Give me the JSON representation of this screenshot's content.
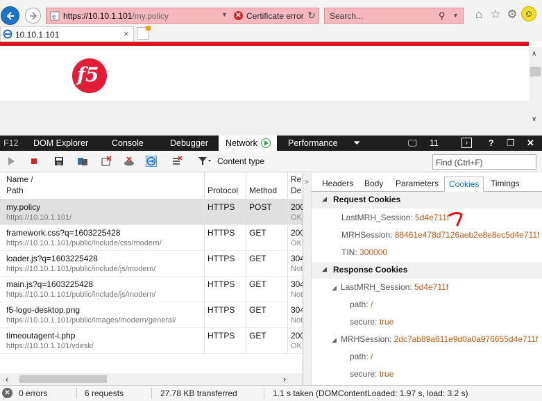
{
  "browser": {
    "address": {
      "scheme_host": "https://10.10.1.101",
      "path": "/my.policy",
      "cert_error_label": "Certificate error"
    },
    "search_placeholder": "Search...",
    "tab_title": "10.10.1.101",
    "icons": [
      "back-icon",
      "forward-icon",
      "home-icon",
      "favorites-star-icon",
      "settings-gear-icon",
      "feedback-smiley-icon"
    ]
  },
  "page": {
    "brand_color": "#d9161f",
    "logo_text": "f5"
  },
  "devtools": {
    "tabs": [
      {
        "label": "F12"
      },
      {
        "label": "DOM Explorer"
      },
      {
        "label": "Console"
      },
      {
        "label": "Debugger"
      },
      {
        "label": "Network"
      },
      {
        "label": "Performance"
      }
    ],
    "active_tab": "Network",
    "emulation_count": "11",
    "help_label": "?",
    "toolbar": {
      "content_type_label": "Content type",
      "find_placeholder": "Find (Ctrl+F)"
    },
    "columns": {
      "name": "Name /",
      "path": "Path",
      "protocol": "Protocol",
      "method": "Method",
      "result_top": "Re",
      "result_bottom": "De"
    },
    "requests": [
      {
        "name": "my.policy",
        "path": "https://10.10.1.101/",
        "protocol": "HTTPS",
        "method": "POST",
        "result": "200",
        "desc": "OK"
      },
      {
        "name": "framework.css?q=1603225428",
        "path": "https://10.10.1.101/public/include/css/modern/",
        "protocol": "HTTPS",
        "method": "GET",
        "result": "200",
        "desc": "OK"
      },
      {
        "name": "loader.js?q=1603225428",
        "path": "https://10.10.1.101/public/include/js/modern/",
        "protocol": "HTTPS",
        "method": "GET",
        "result": "304",
        "desc": "Not"
      },
      {
        "name": "main.js?q=1603225428",
        "path": "https://10.10.1.101/public/include/js/modern/",
        "protocol": "HTTPS",
        "method": "GET",
        "result": "304",
        "desc": "Not"
      },
      {
        "name": "f5-logo-desktop.png",
        "path": "https://10.10.1.101/public/images/modern/general/",
        "protocol": "HTTPS",
        "method": "GET",
        "result": "304",
        "desc": "Not"
      },
      {
        "name": "timeoutagent-i.php",
        "path": "https://10.10.1.101/vdesk/",
        "protocol": "HTTPS",
        "method": "GET",
        "result": "200",
        "desc": "OK"
      }
    ],
    "detail_tabs": [
      "Headers",
      "Body",
      "Parameters",
      "Cookies",
      "Timings"
    ],
    "active_detail_tab": "Cookies",
    "request_cookies": {
      "title": "Request Cookies",
      "items": [
        {
          "key": "LastMRH_Session",
          "value": "5d4e711f"
        },
        {
          "key": "MRHSession",
          "value": "88461e478d7126aeb2e8e8ec5d4e711f"
        },
        {
          "key": "TIN",
          "value": "300000"
        }
      ]
    },
    "response_cookies": {
      "title": "Response Cookies",
      "items": [
        {
          "key": "LastMRH_Session",
          "value": "5d4e711f",
          "path": "/",
          "secure": "true"
        },
        {
          "key": "MRHSession",
          "value": "2dc7ab89a611e9d0a0a976655d4e711f",
          "path": "/",
          "secure": "true"
        }
      ],
      "path_label": "path",
      "secure_label": "secure"
    },
    "status": {
      "errors": "0 errors",
      "requests": "6 requests",
      "transferred": "27.78 KB transferred",
      "timing": "1.1 s taken (DOMContentLoaded: 1.97 s, load: 3.2 s)"
    },
    "value_color": "#c55a11"
  }
}
